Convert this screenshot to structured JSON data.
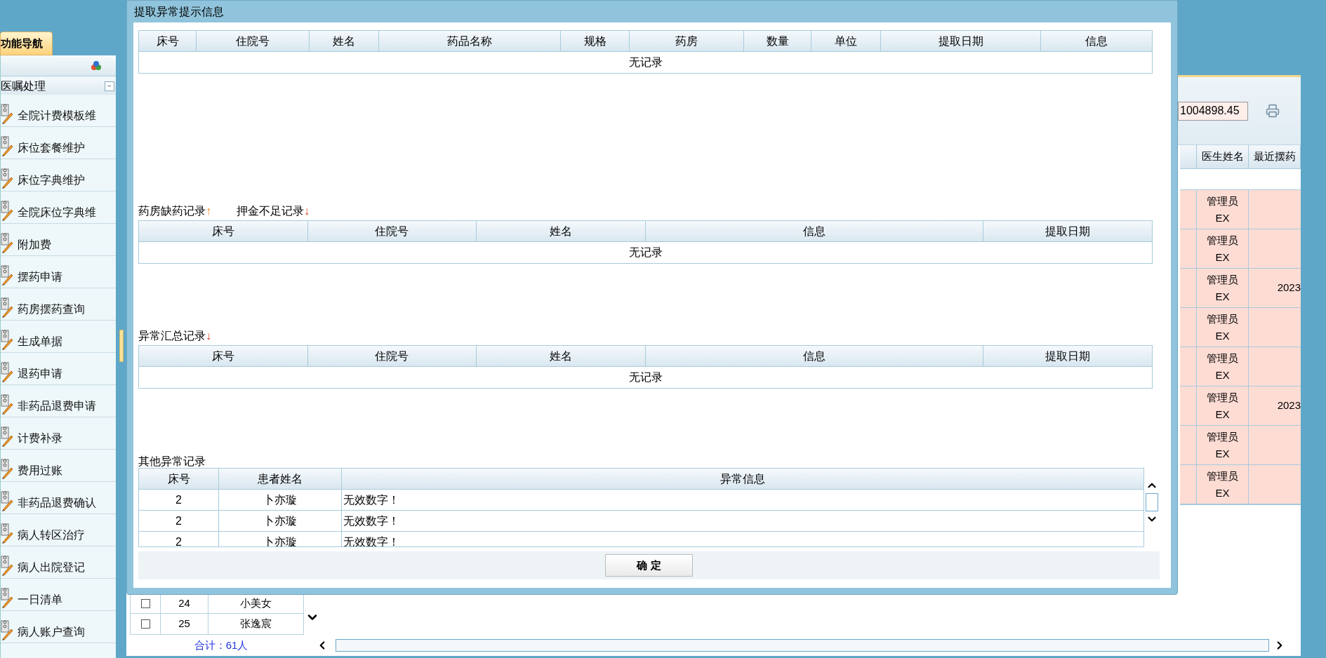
{
  "sidebar": {
    "tab": "功能导航",
    "section": {
      "title": "医嘱处理",
      "collapse": "−"
    },
    "items": [
      "全院计费模板维",
      "床位套餐维护",
      "床位字典维护",
      "全院床位字典维",
      "附加费",
      "摆药申请",
      "药房摆药查询",
      "生成单据",
      "退药申请",
      "非药品退费申请",
      "计费补录",
      "费用过账",
      "非药品退费确认",
      "病人转区治疗",
      "病人出院登记",
      "一日清单",
      "病人账户查询"
    ]
  },
  "background": {
    "amount": "1004898.45",
    "columns": [
      "医生姓名",
      "最近摆药"
    ],
    "rows": [
      {
        "doctor": "管理员",
        "code": "EX"
      },
      {
        "doctor": "管理员",
        "code": "EX"
      },
      {
        "doctor": "管理员",
        "code": "EX",
        "date": "2023"
      },
      {
        "doctor": "管理员",
        "code": "EX"
      },
      {
        "doctor": "管理员",
        "code": "EX"
      },
      {
        "doctor": "管理员",
        "code": "EX",
        "date": "2023"
      },
      {
        "doctor": "管理员",
        "code": "EX"
      },
      {
        "doctor": "管理员",
        "code": "EX"
      }
    ],
    "patients": [
      {
        "checked": false,
        "bed": "24",
        "name": "小美女"
      },
      {
        "checked": false,
        "bed": "25",
        "name": "张逸宸"
      }
    ],
    "total": "合计：61人"
  },
  "dialog": {
    "title": "提取异常提示信息",
    "sections": [
      {
        "columns": [
          "床号",
          "住院号",
          "姓名",
          "药品名称",
          "规格",
          "药房",
          "数量",
          "单位",
          "提取日期",
          "信息"
        ],
        "empty": "无记录"
      },
      {
        "labels": [
          {
            "text": "药房缺药记录",
            "arrow": "↑"
          },
          {
            "text": "押金不足记录",
            "arrow": "↓"
          }
        ],
        "columns": [
          "床号",
          "住院号",
          "姓名",
          "信息",
          "提取日期"
        ],
        "empty": "无记录"
      },
      {
        "labels": [
          {
            "text": "异常汇总记录",
            "arrow": "↓"
          }
        ],
        "columns": [
          "床号",
          "住院号",
          "姓名",
          "信息",
          "提取日期"
        ],
        "empty": "无记录"
      }
    ],
    "other": {
      "label": "其他异常记录",
      "columns": [
        "床号",
        "患者姓名",
        "异常信息"
      ],
      "rows": [
        [
          "2",
          "卜亦璇",
          "无效数字！"
        ],
        [
          "2",
          "卜亦璇",
          "无效数字！"
        ],
        [
          "2",
          "卜亦璇",
          "无效数字！"
        ]
      ]
    },
    "ok_button": "确 定"
  }
}
